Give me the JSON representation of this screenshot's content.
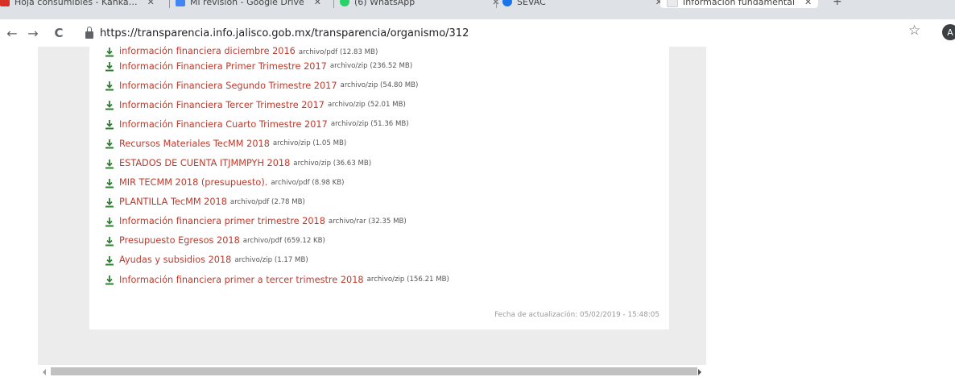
{
  "tabs": [
    {
      "title": "Hoja consumibles - Kanka…",
      "favicon_color": "#d93025"
    },
    {
      "title": "Mi revisión - Google Drive",
      "favicon_color": "#4285f4"
    },
    {
      "title": "(6) WhatsApp",
      "favicon_color": "#25d366"
    },
    {
      "title": "SEVAC",
      "favicon_color": "#1a73e8"
    },
    {
      "title": "Información fundamental",
      "favicon_color": "#e8eaed",
      "active": true
    }
  ],
  "toolbar": {
    "back_icon": "←",
    "forward_icon": "→",
    "reload_icon": "C",
    "url": "https://transparencia.info.jalisco.gob.mx/transparencia/organismo/312",
    "bookmark_icon": "☆",
    "avatar_initial": "A"
  },
  "files": [
    {
      "name": "información financiera diciembre 2016",
      "meta": "archivo/pdf (12.83 MB)"
    },
    {
      "name": "Información Financiera Primer Trimestre 2017",
      "meta": "archivo/zip (236.52 MB)"
    },
    {
      "name": "Información Financiera Segundo Trimestre 2017",
      "meta": "archivo/zip (54.80 MB)"
    },
    {
      "name": "Información Financiera Tercer Trimestre 2017",
      "meta": "archivo/zip (52.01 MB)"
    },
    {
      "name": "Información Financiera Cuarto Trimestre 2017",
      "meta": "archivo/zip (51.36 MB)"
    },
    {
      "name": "Recursos Materiales TecMM 2018",
      "meta": "archivo/zip (1.05 MB)"
    },
    {
      "name": "ESTADOS DE CUENTA ITJMMPYH 2018",
      "meta": "archivo/zip (36.63 MB)"
    },
    {
      "name": "MIR TECMM 2018 (presupuesto).",
      "meta": "archivo/pdf (8.98 KB)"
    },
    {
      "name": "PLANTILLA TecMM 2018",
      "meta": "archivo/pdf (2.78 MB)"
    },
    {
      "name": "Información financiera primer trimestre 2018",
      "meta": "archivo/rar (32.35 MB)"
    },
    {
      "name": "Presupuesto Egresos 2018",
      "meta": "archivo/pdf (659.12 KB)"
    },
    {
      "name": "Ayudas y subsidios 2018",
      "meta": "archivo/zip (1.17 MB)"
    },
    {
      "name": "Información financiera primer a tercer trimestre 2018",
      "meta": "archivo/zip (156.21 MB)"
    }
  ],
  "updated": "Fecha de actualización: 05/02/2019 - 15:48:05",
  "colors": {
    "link": "#c0392b",
    "download_icon": "#2e7d32"
  }
}
